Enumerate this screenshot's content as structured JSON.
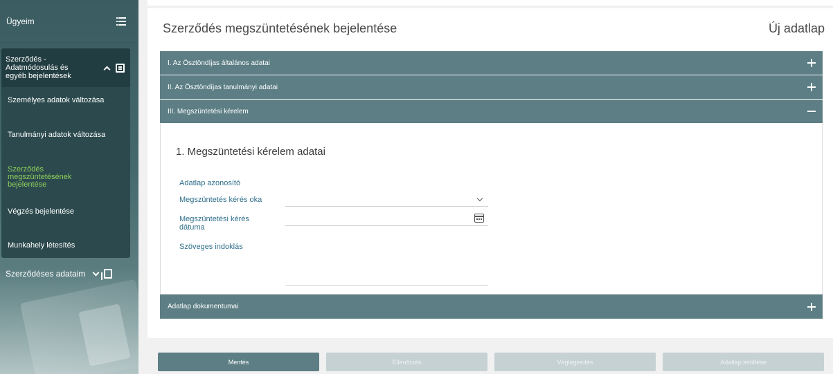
{
  "sidebar": {
    "top_label": "Ügyeim",
    "panel_header": "Szerződés - Adatmódosulás és egyéb bejelentések",
    "items": [
      {
        "label": "Személyes adatok változása",
        "active": false
      },
      {
        "label": "Tanulmányi adatok változása",
        "active": false
      },
      {
        "label": "Szerződés megszüntetésének bejelentése",
        "active": true
      },
      {
        "label": "Végzés bejelentése",
        "active": false
      },
      {
        "label": "Munkahely létesítés",
        "active": false
      }
    ],
    "bottom_label": "Szerződéses adataim"
  },
  "page": {
    "title": "Szerződés megszüntetésének bejelentése",
    "subtitle": "Új adatlap"
  },
  "accordion": {
    "sections": [
      {
        "label": "I. Az Ösztöndíjas általános adatai",
        "expanded": false
      },
      {
        "label": "II. Az Ösztöndíjas tanulmányi adatai",
        "expanded": false
      },
      {
        "label": "III. Megszüntetési kérelem",
        "expanded": true
      },
      {
        "label": "Adatlap dokumentumai",
        "expanded": false
      }
    ]
  },
  "form": {
    "section_title": "1. Megszüntetési kérelem adatai",
    "fields": {
      "id_label": "Adatlap azonosító",
      "reason_label": "Megszüntetés kérés oka",
      "reason_value": "",
      "date_label": "Megszüntetési kérés dátuma",
      "date_value": "",
      "text_label": "Szöveges indoklás",
      "text_value": ""
    }
  },
  "buttons": {
    "save": "Mentés",
    "check": "Ellenőrzés",
    "finalize": "Véglegesítés",
    "download": "Adatlap letöltése"
  },
  "colors": {
    "accent": "#5c7e84",
    "sidebar": "#2c4a4e",
    "active_item": "#8ecf59",
    "label": "#2f6e8a"
  }
}
